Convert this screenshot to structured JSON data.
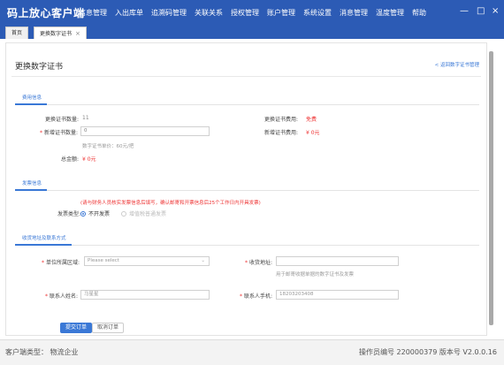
{
  "app": {
    "title": "码上放心客户端"
  },
  "menu": [
    "信息管理",
    "入出库单",
    "追溯码管理",
    "关联关系",
    "授权管理",
    "账户管理",
    "系统设置",
    "消息管理",
    "温度管理",
    "帮助"
  ],
  "window": {
    "minimize": "—",
    "maximize": "□",
    "close": "×"
  },
  "tabs": [
    {
      "label": "首页"
    },
    {
      "label": "更换数字证书",
      "close": "×"
    }
  ],
  "page": {
    "title": "更换数字证书",
    "back": "< 返回数字证书管理"
  },
  "basic": {
    "heading": "费用信息",
    "cert_count_label": "更换证书数量:",
    "cert_count_value": "11",
    "cert_fee_label": "更换证书费用:",
    "cert_fee_value": "免费",
    "new_count_label": "新增证书数量:",
    "new_count_value": "0",
    "new_fee_label": "新增证书费用:",
    "new_fee_value": "¥ 0元",
    "unit_price": "数字证书单价：60元/把",
    "total_label": "总金额:",
    "total_value": "¥ 0元"
  },
  "invoice": {
    "heading": "发票信息",
    "notice": "(请与财务人员核实发票信息后填写，确认邮寄和开票信息后25个工作日内开具发票)",
    "type_label": "发票类型:",
    "option_none": "不开发票",
    "option_general": "增值税普通发票"
  },
  "address": {
    "heading": "收货地址及联系方式",
    "region_label": "单位所属区域:",
    "region_placeholder": "Please select",
    "receive_label": "收货地址:",
    "receive_value": "",
    "receive_hint": "用于邮寄收据单据的数字证书及发票",
    "contact_label": "联系人姓名:",
    "contact_value": "马星星",
    "phone_label": "联系人手机:",
    "phone_value": "18203203408"
  },
  "actions": {
    "submit": "提交订单",
    "cancel": "取消订单"
  },
  "footer": {
    "client_type": "客户端类型：  物流企业",
    "operator": "操作员编号  220000379  版本号  V2.0.0.16"
  },
  "colors": {
    "titlebar": "#2c5bb5",
    "accent": "#3a78d6",
    "required": "#e33333"
  }
}
